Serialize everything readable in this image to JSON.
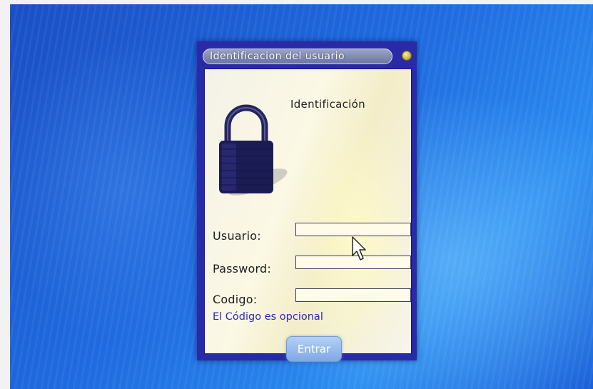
{
  "dialog": {
    "title": "Identificacion del usuario",
    "heading": "Identificación",
    "icons": {
      "close": "close-icon",
      "lock": "padlock-icon",
      "pointer": "mouse-pointer-icon"
    }
  },
  "form": {
    "fields": [
      {
        "label": "Usuario:",
        "value": ""
      },
      {
        "label": "Password:",
        "value": ""
      },
      {
        "label": "Codigo:",
        "value": ""
      }
    ],
    "hint": "El Código es opcional",
    "submit_label": "Entrar"
  },
  "colors": {
    "desktop": "#1f6ae0",
    "dialog_border": "#2a2aa8",
    "hint_text": "#2a2ab8",
    "button": "#7fa8e6"
  }
}
